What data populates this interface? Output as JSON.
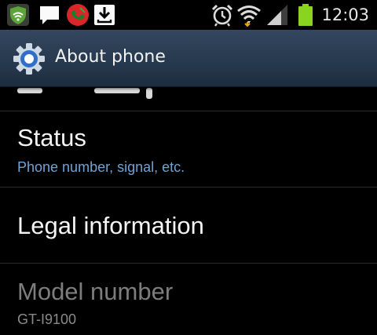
{
  "status_bar": {
    "time": "12:03",
    "icons": [
      "shield-icon",
      "message-icon",
      "missed-call-icon",
      "download-icon",
      "alarm-icon",
      "wifi-icon",
      "signal-icon",
      "battery-icon"
    ],
    "colors": {
      "shield": "#5ca53a",
      "missed_call": "#d9262a",
      "battery": "#8ad31e"
    }
  },
  "action_bar": {
    "title": "About phone",
    "icon": "settings-gear-icon",
    "background": "#2a3d53"
  },
  "list": {
    "items": [
      {
        "title": "Status",
        "summary": "Phone number, signal, etc.",
        "enabled": true
      },
      {
        "title": "Legal information",
        "summary": "",
        "enabled": true
      },
      {
        "title": "Model number",
        "summary": "GT-I9100",
        "enabled": false
      }
    ],
    "summary_color": "#6fa3d2"
  }
}
